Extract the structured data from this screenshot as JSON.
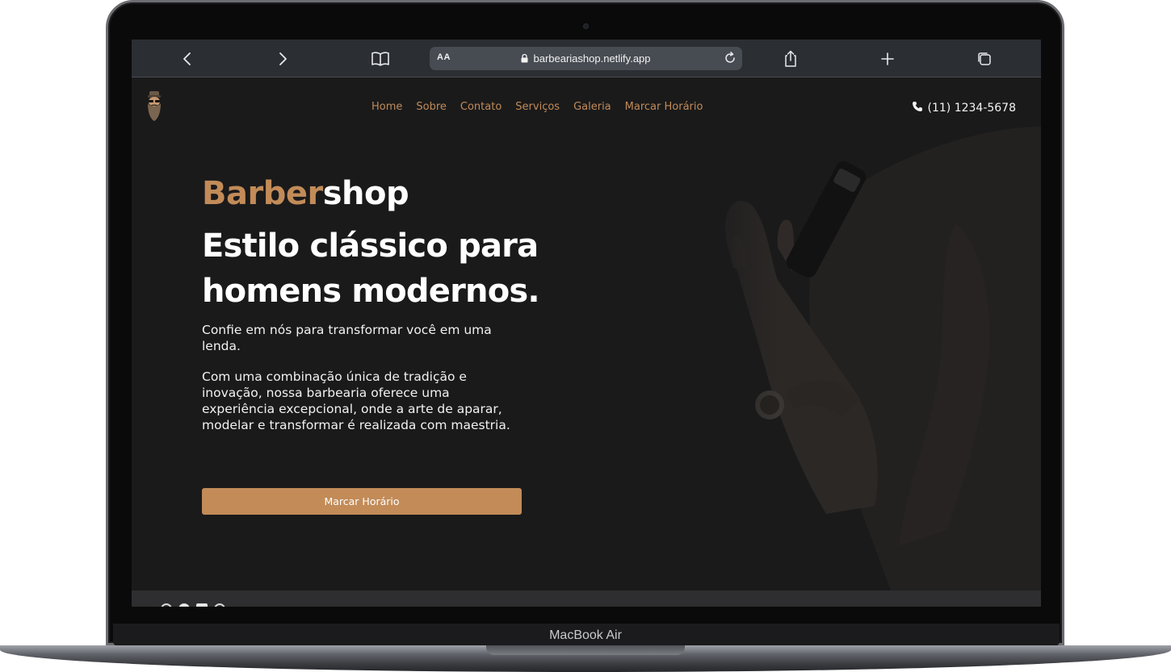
{
  "device": {
    "label": "MacBook Air"
  },
  "browser": {
    "address_text_size": "AA",
    "url": "barbeariashop.netlify.app",
    "icons": [
      "chevron-left-icon",
      "chevron-right-icon",
      "book-icon",
      "lock-icon",
      "reload-icon",
      "share-icon",
      "plus-icon",
      "tabs-icon"
    ]
  },
  "site": {
    "nav": [
      {
        "label": "Home"
      },
      {
        "label": "Sobre"
      },
      {
        "label": "Contato"
      },
      {
        "label": "Serviços"
      },
      {
        "label": "Galeria"
      },
      {
        "label": "Marcar Horário"
      }
    ],
    "phone": "(11) 1234-5678",
    "brand_part_1": "Barber",
    "brand_part_2": "shop",
    "headline": "Estilo clássico para homens modernos.",
    "paragraph_1": "Confie em nós para transformar você em uma lenda.",
    "paragraph_2": "Com uma combinação única de tradição e inovação, nossa barbearia oferece uma experiência excepcional, onde a arte de aparar, modelar e transformar é realizada com maestria.",
    "cta_label": "Marcar Horário",
    "colors": {
      "accent": "#c28b58",
      "background": "#1a1a1b",
      "text": "#ffffff"
    }
  }
}
